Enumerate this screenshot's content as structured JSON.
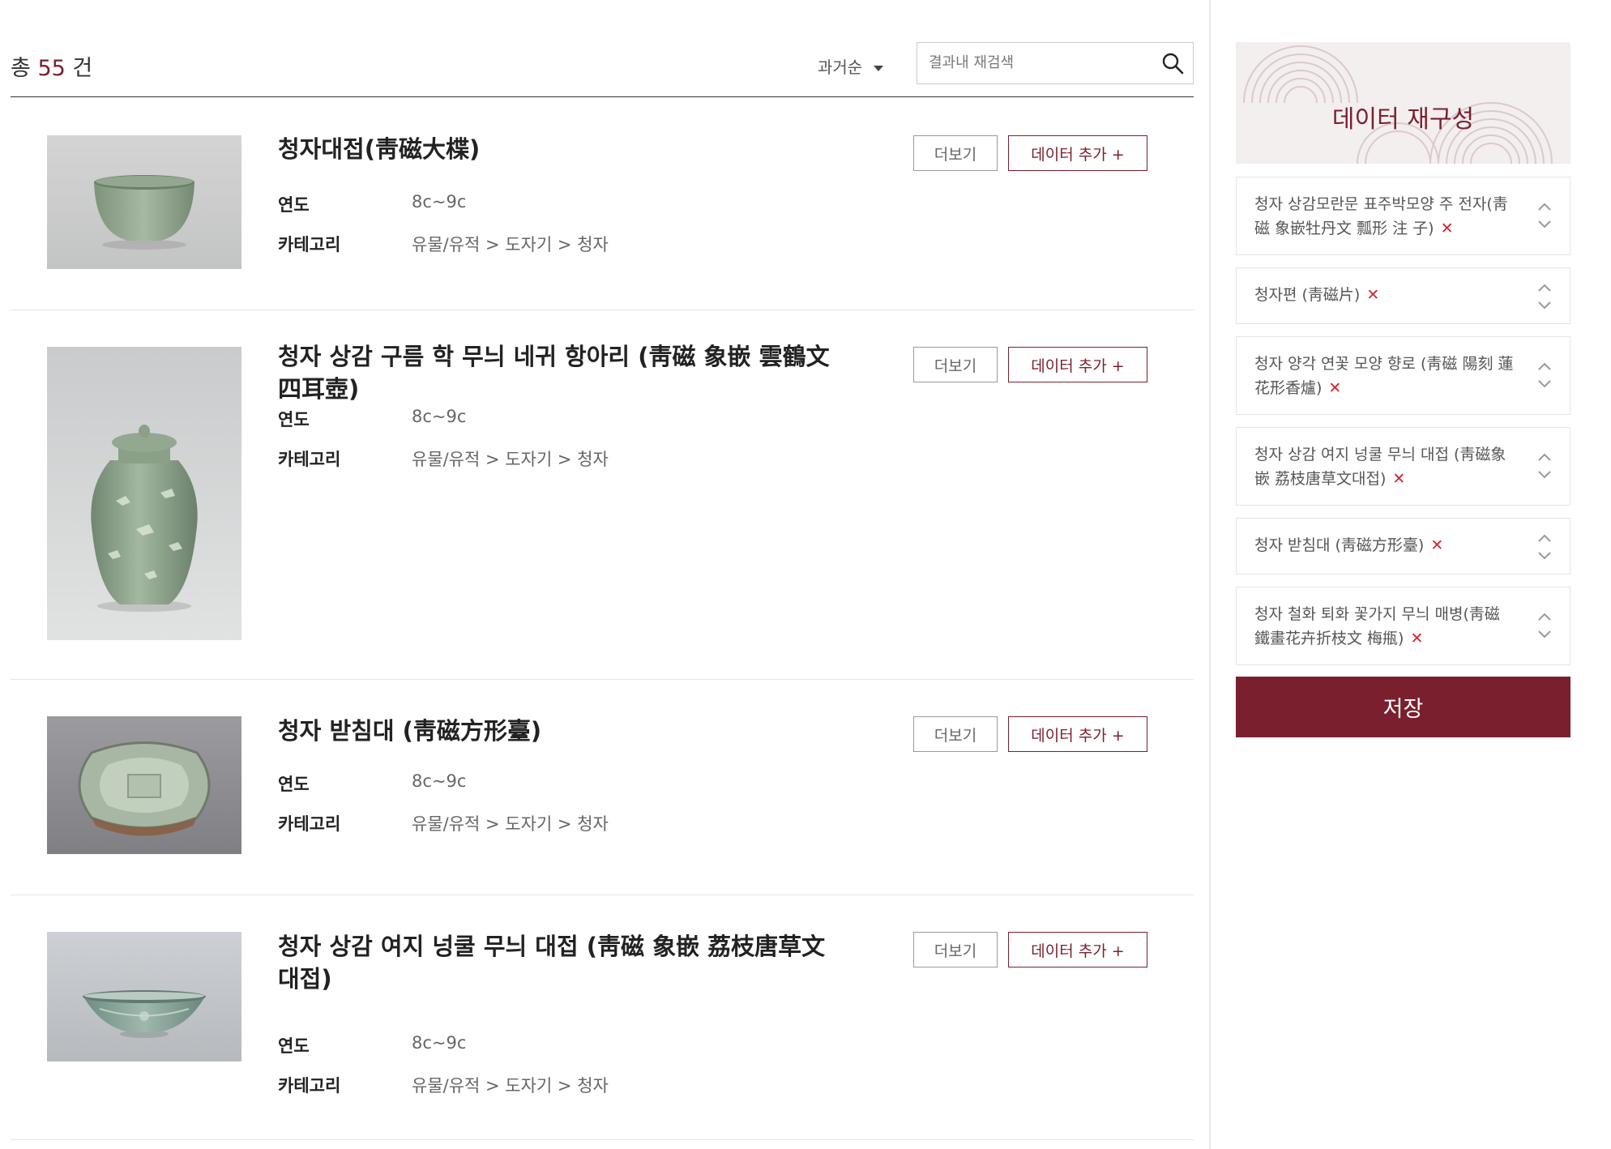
{
  "results": {
    "total_prefix": "총",
    "total_count": "55",
    "total_suffix": "건",
    "sort_label": "과거순",
    "search_placeholder": "결과내 재검색"
  },
  "labels": {
    "year": "연도",
    "category": "카테고리",
    "more_button": "더보기",
    "add_button": "데이터 추가 +"
  },
  "items": [
    {
      "title": "청자대접(靑磁大楪)",
      "year": "8c~9c",
      "category": "유물/유적 > 도자기 > 청자"
    },
    {
      "title": "청자 상감 구름 학 무늬 네귀 항아리 (靑磁 象嵌 雲鶴文 四耳壺)",
      "year": "8c~9c",
      "category": "유물/유적 > 도자기 > 청자"
    },
    {
      "title": "청자 받침대 (靑磁方形臺)",
      "year": "8c~9c",
      "category": "유물/유적 > 도자기 > 청자"
    },
    {
      "title": "청자 상감 여지 넝쿨 무늬 대접 (靑磁 象嵌 荔枝唐草文 대접)",
      "year": "8c~9c",
      "category": "유물/유적 > 도자기 > 청자"
    }
  ],
  "panel": {
    "title": "데이터 재구성",
    "items": [
      "청자 상감모란문 표주박모양 주 전자(靑磁 象嵌牡丹文 瓢形 注 子)",
      "청자편 (靑磁片)",
      "청자 양각 연꽃 모양 향로 (靑磁 陽刻 蓮花形香爐)",
      "청자 상감 여지 넝쿨 무늬 대접 (靑磁象嵌 荔枝唐草文대접)",
      "청자 받침대 (靑磁方形臺)",
      "청자 철화 퇴화 꽃가지 무늬 매병(靑磁鐵畫花卉折枝文 梅甁)"
    ],
    "remove_symbol": "✕",
    "save_label": "저장"
  },
  "colors": {
    "accent": "#7a1f2e",
    "remove": "#d2262f",
    "celadon": "#8fa88f"
  }
}
